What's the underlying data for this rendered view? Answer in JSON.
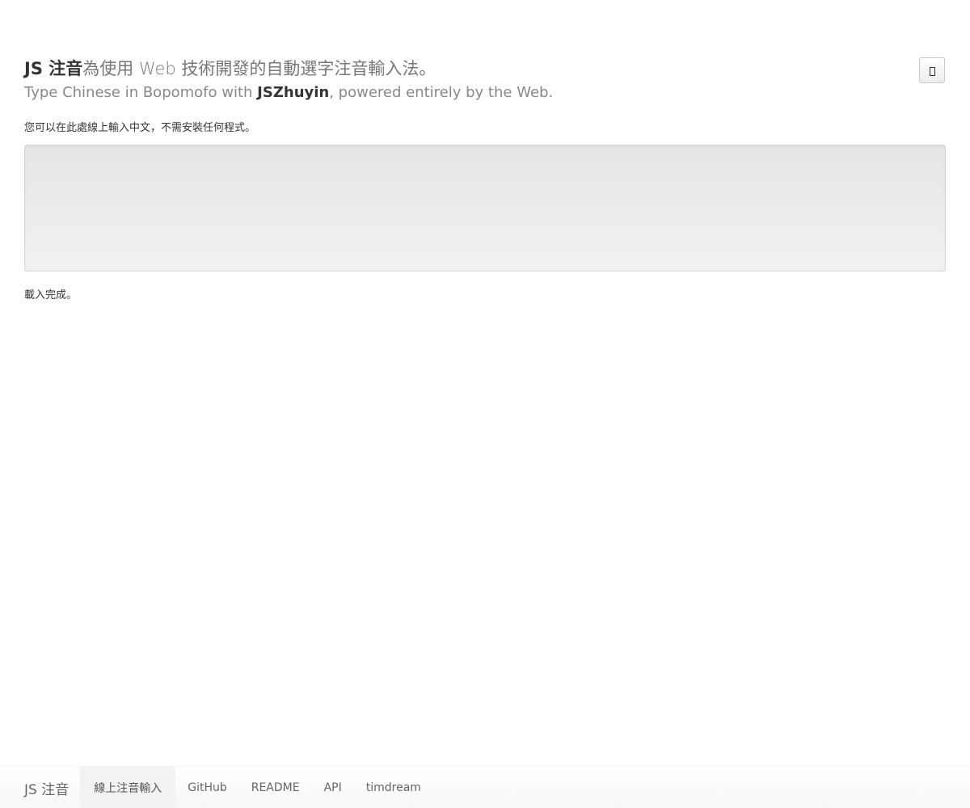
{
  "header": {
    "brand": "JS 注音",
    "tagline": "為使用 Web 技術開發的自動選字注音輸入法。",
    "subtitle_before": "Type Chinese in Bopomofo with ",
    "subtitle_brand": "JSZhuyin",
    "subtitle_after": ", powered entirely by the Web."
  },
  "settings_button": {
    "icon": "settings-icon"
  },
  "hint": "您可以在此處線上輸入中文，不需安裝任何程式。",
  "editor": {
    "value": ""
  },
  "status": "載入完成。",
  "footer": {
    "brand": "JS 注音",
    "nav": [
      {
        "label": "線上注音輸入",
        "active": true
      },
      {
        "label": "GitHub",
        "active": false
      },
      {
        "label": "README",
        "active": false
      },
      {
        "label": "API",
        "active": false
      },
      {
        "label": "timdream",
        "active": false
      }
    ]
  }
}
